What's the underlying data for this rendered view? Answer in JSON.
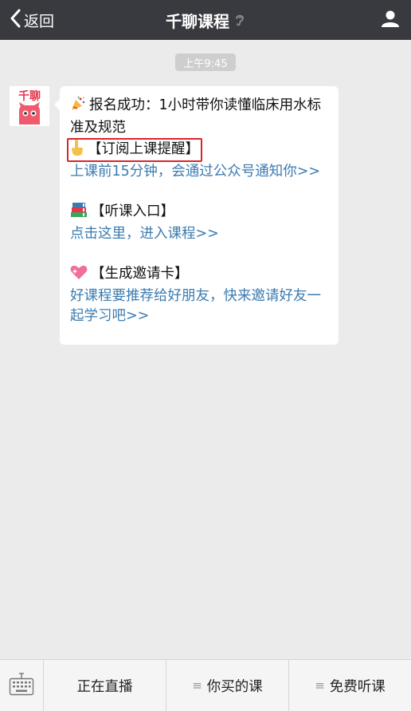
{
  "nav": {
    "back_label": "返回",
    "title": "千聊课程"
  },
  "chat": {
    "time": "上午9:45",
    "avatar_text": "千聊",
    "message": {
      "line1": "报名成功：1小时带你读懂临床用水标准及规范",
      "subscribe_title": "【订阅上课提醒】",
      "subscribe_link": "上课前15分钟，会通过公众号通知你>>",
      "listen_title": "【听课入口】",
      "listen_link": "点击这里，进入课程>>",
      "invite_title": "【生成邀请卡】",
      "invite_link": "好课程要推荐给好朋友，快来邀请好友一起学习吧>>"
    }
  },
  "bottom_menu": {
    "items": [
      "正在直播",
      "你买的课",
      "免费听课"
    ]
  },
  "colors": {
    "nav_bg": "#393a3f",
    "chat_bg": "#ebebeb",
    "link": "#3b7bb0",
    "highlight_box": "#d8262a"
  },
  "icons": {
    "back": "chevron-left-icon",
    "ear": "ear-icon",
    "user": "user-icon",
    "party": "party-popper-icon",
    "point_down": "pointing-down-icon",
    "books": "books-icon",
    "heart": "sparkling-heart-icon",
    "keyboard": "keyboard-icon",
    "menu": "menu-lines-icon"
  }
}
